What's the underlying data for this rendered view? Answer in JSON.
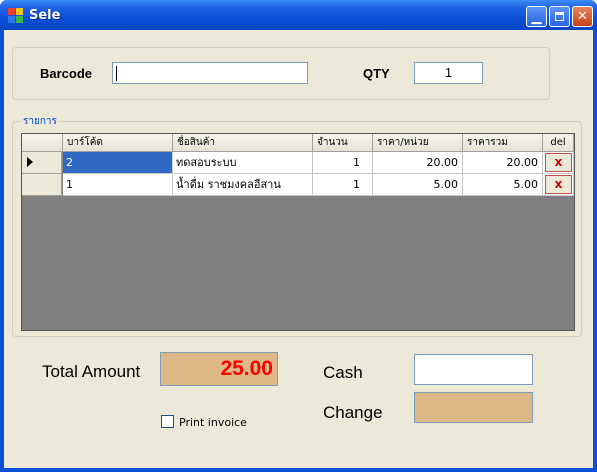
{
  "window": {
    "title": "Sele"
  },
  "input_panel": {
    "barcode_label": "Barcode",
    "barcode_value": "",
    "qty_label": "QTY",
    "qty_value": "1"
  },
  "items_group": {
    "title": "รายการ",
    "columns": [
      "บาร์โค้ด",
      "ชื่อสินค้า",
      "จำนวน",
      "ราคา/หน่วย",
      "ราคารวม",
      "del"
    ],
    "rows": [
      {
        "barcode": "2",
        "name": "ทดสอบระบบ",
        "qty": "1",
        "unit_price": "20.00",
        "total": "20.00",
        "del": "x"
      },
      {
        "barcode": "1",
        "name": "น้ำดื่ม ราชมงคลอีสาน",
        "qty": "1",
        "unit_price": "5.00",
        "total": "5.00",
        "del": "x"
      }
    ]
  },
  "summary": {
    "total_label": "Total Amount",
    "total_value": "25.00",
    "cash_label": "Cash",
    "cash_value": "",
    "change_label": "Change",
    "change_value": "",
    "print_label": "Print invoice",
    "print_checked": false
  },
  "colors": {
    "titlebar": "#0a50d8",
    "client_bg": "#ece9d8",
    "readonly_bg": "#deb887",
    "total_text": "#ff0000",
    "group_title": "#0046d5",
    "selection": "#316ac5",
    "grid_bg": "#808080"
  }
}
